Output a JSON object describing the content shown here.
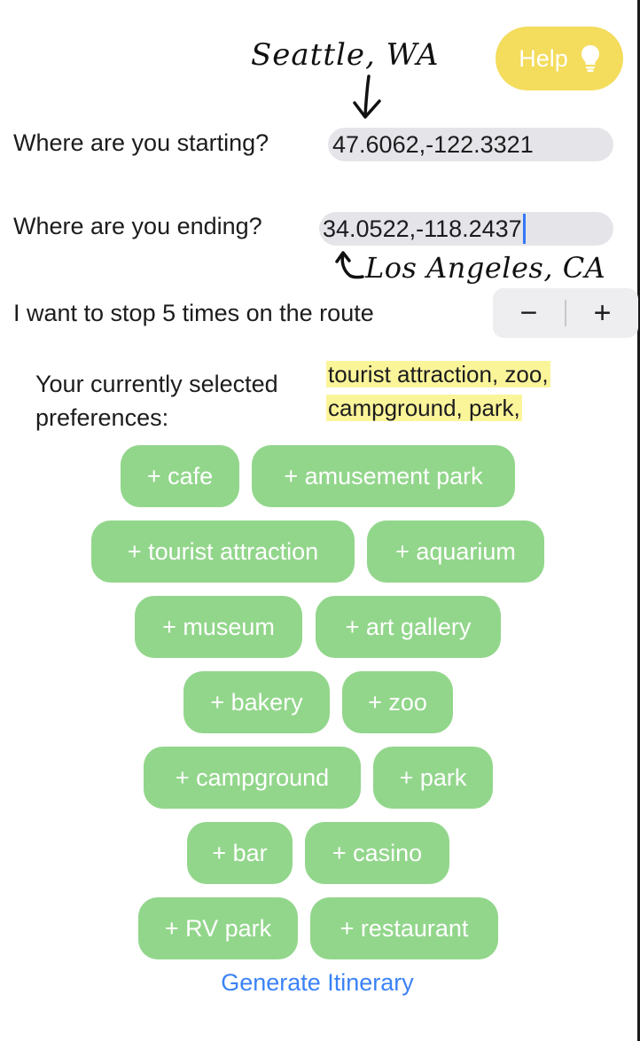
{
  "help": {
    "label": "Help",
    "icon": "lightbulb-icon",
    "color": "#f4dc5c"
  },
  "annotations": {
    "start_note": "Seattle, WA",
    "end_note": "Los Angeles, CA"
  },
  "start": {
    "question": "Where are you starting?",
    "value": "47.6062,-122.3321"
  },
  "end": {
    "question": "Where are you ending?",
    "value": "34.0522,-118.2437"
  },
  "stops": {
    "label": "I want to stop 5 times on the route",
    "count": 5,
    "minus": "−",
    "plus": "+"
  },
  "preferences": {
    "label": "Your currently selected preferences:",
    "line1": "tourist  attraction, zoo,",
    "line2": "campground, park,"
  },
  "chips": [
    "+ cafe",
    "+ amusement park",
    "+ tourist attraction",
    "+ aquarium",
    "+ museum",
    "+ art gallery",
    "+ bakery",
    "+ zoo",
    "+ campground",
    "+ park",
    "+ bar",
    "+ casino",
    "+ RV park",
    "+ restaurant"
  ],
  "chip_color": "#92d68b",
  "generate": {
    "label": "Generate Itinerary",
    "color": "#3a82f7"
  }
}
